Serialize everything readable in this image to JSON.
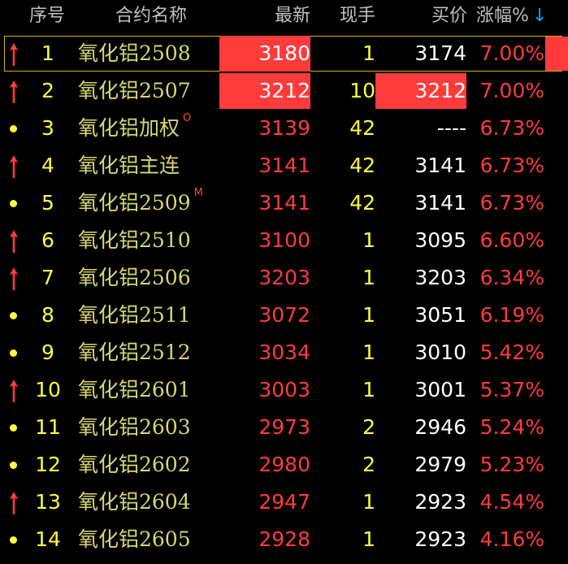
{
  "header": {
    "seq": "序号",
    "name": "合约名称",
    "last": "最新",
    "volume": "现手",
    "bid": "买价",
    "change": "涨幅%",
    "sort_indicator": "↓"
  },
  "colors": {
    "up": "#ff3b3b",
    "yellow": "#ffff3c",
    "name": "#d8d870",
    "white": "#ffffff",
    "header": "#c0c0c0",
    "selection": "#d4b300"
  },
  "rows": [
    {
      "seq": "1",
      "name": "氧化铝2508",
      "tag": "",
      "last": "3180",
      "volume": "1",
      "bid": "3174",
      "change": "7.00%",
      "indicator": "up-arrow-icon",
      "last_hl": true,
      "bid_hl": false,
      "selected": true
    },
    {
      "seq": "2",
      "name": "氧化铝2507",
      "tag": "",
      "last": "3212",
      "volume": "10",
      "bid": "3212",
      "change": "7.00%",
      "indicator": "up-arrow-icon",
      "last_hl": true,
      "bid_hl": true,
      "selected": false
    },
    {
      "seq": "3",
      "name": "氧化铝加权",
      "tag": "O",
      "last": "3139",
      "volume": "42",
      "bid": "----",
      "change": "6.73%",
      "indicator": "dot-icon",
      "last_hl": false,
      "bid_hl": false,
      "selected": false
    },
    {
      "seq": "4",
      "name": "氧化铝主连",
      "tag": "",
      "last": "3141",
      "volume": "42",
      "bid": "3141",
      "change": "6.73%",
      "indicator": "up-arrow-icon",
      "last_hl": false,
      "bid_hl": false,
      "selected": false
    },
    {
      "seq": "5",
      "name": "氧化铝2509",
      "tag": "M",
      "last": "3141",
      "volume": "42",
      "bid": "3141",
      "change": "6.73%",
      "indicator": "dot-icon",
      "last_hl": false,
      "bid_hl": false,
      "selected": false
    },
    {
      "seq": "6",
      "name": "氧化铝2510",
      "tag": "",
      "last": "3100",
      "volume": "1",
      "bid": "3095",
      "change": "6.60%",
      "indicator": "up-arrow-icon",
      "last_hl": false,
      "bid_hl": false,
      "selected": false
    },
    {
      "seq": "7",
      "name": "氧化铝2506",
      "tag": "",
      "last": "3203",
      "volume": "1",
      "bid": "3203",
      "change": "6.34%",
      "indicator": "up-arrow-icon",
      "last_hl": false,
      "bid_hl": false,
      "selected": false
    },
    {
      "seq": "8",
      "name": "氧化铝2511",
      "tag": "",
      "last": "3072",
      "volume": "1",
      "bid": "3051",
      "change": "6.19%",
      "indicator": "dot-icon",
      "last_hl": false,
      "bid_hl": false,
      "selected": false
    },
    {
      "seq": "9",
      "name": "氧化铝2512",
      "tag": "",
      "last": "3034",
      "volume": "1",
      "bid": "3010",
      "change": "5.42%",
      "indicator": "dot-icon",
      "last_hl": false,
      "bid_hl": false,
      "selected": false
    },
    {
      "seq": "10",
      "name": "氧化铝2601",
      "tag": "",
      "last": "3003",
      "volume": "1",
      "bid": "3001",
      "change": "5.37%",
      "indicator": "up-arrow-icon",
      "last_hl": false,
      "bid_hl": false,
      "selected": false
    },
    {
      "seq": "11",
      "name": "氧化铝2603",
      "tag": "",
      "last": "2973",
      "volume": "2",
      "bid": "2946",
      "change": "5.24%",
      "indicator": "dot-icon",
      "last_hl": false,
      "bid_hl": false,
      "selected": false
    },
    {
      "seq": "12",
      "name": "氧化铝2602",
      "tag": "",
      "last": "2980",
      "volume": "2",
      "bid": "2979",
      "change": "5.23%",
      "indicator": "dot-icon",
      "last_hl": false,
      "bid_hl": false,
      "selected": false
    },
    {
      "seq": "13",
      "name": "氧化铝2604",
      "tag": "",
      "last": "2947",
      "volume": "1",
      "bid": "2923",
      "change": "4.54%",
      "indicator": "up-arrow-icon",
      "last_hl": false,
      "bid_hl": false,
      "selected": false
    },
    {
      "seq": "14",
      "name": "氧化铝2605",
      "tag": "",
      "last": "2928",
      "volume": "1",
      "bid": "2923",
      "change": "4.16%",
      "indicator": "dot-icon",
      "last_hl": false,
      "bid_hl": false,
      "selected": false
    }
  ]
}
